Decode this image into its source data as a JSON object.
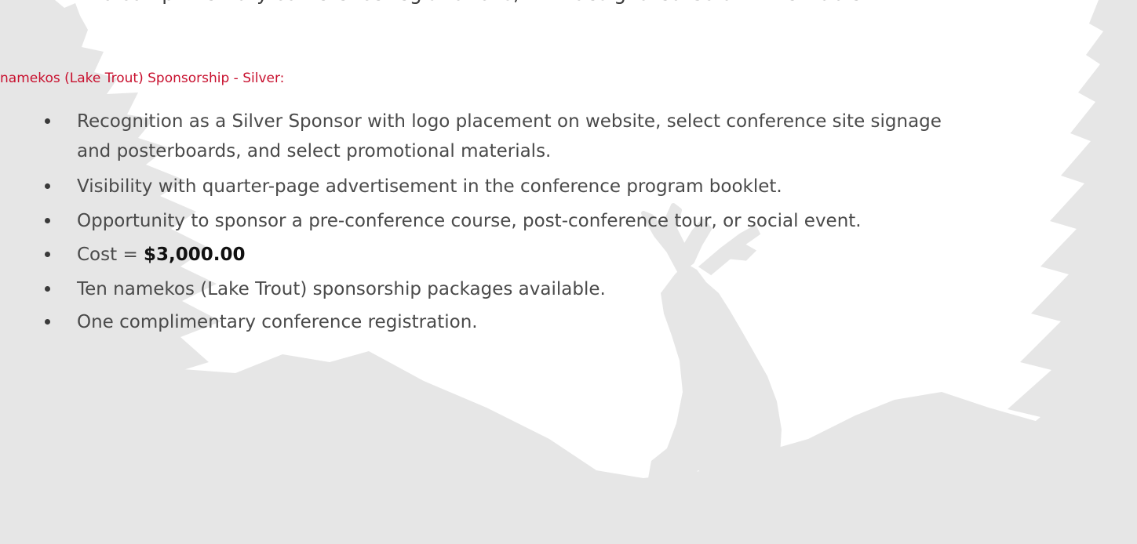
{
  "previous_item": "Two complimentary conference registrations, with designated Gala Dinner table.",
  "section": {
    "heading": "namekos (Lake Trout) Sponsorship - Silver:"
  },
  "benefits": {
    "recognition_line1": "Recognition as a Silver Sponsor with logo placement on website, select conference site signage",
    "recognition_line2": "and posterboards, and select promotional materials.",
    "visibility": "Visibility with quarter-page advertisement in the conference program booklet.",
    "opportunity": "Opportunity to sponsor a pre-conference course, post-conference tour, or social event.",
    "cost_label": "Cost = ",
    "cost_value": "$3,000.00",
    "packages": "Ten namekos (Lake Trout) sponsorship packages available.",
    "registration": "One complimentary conference registration."
  },
  "colors": {
    "heading": "#c8102e",
    "body_text": "#4a4a4a",
    "silhouette": "#e6e6e6",
    "background": "#ffffff"
  },
  "icons": {
    "background": "forest-wolf-silhouette"
  }
}
